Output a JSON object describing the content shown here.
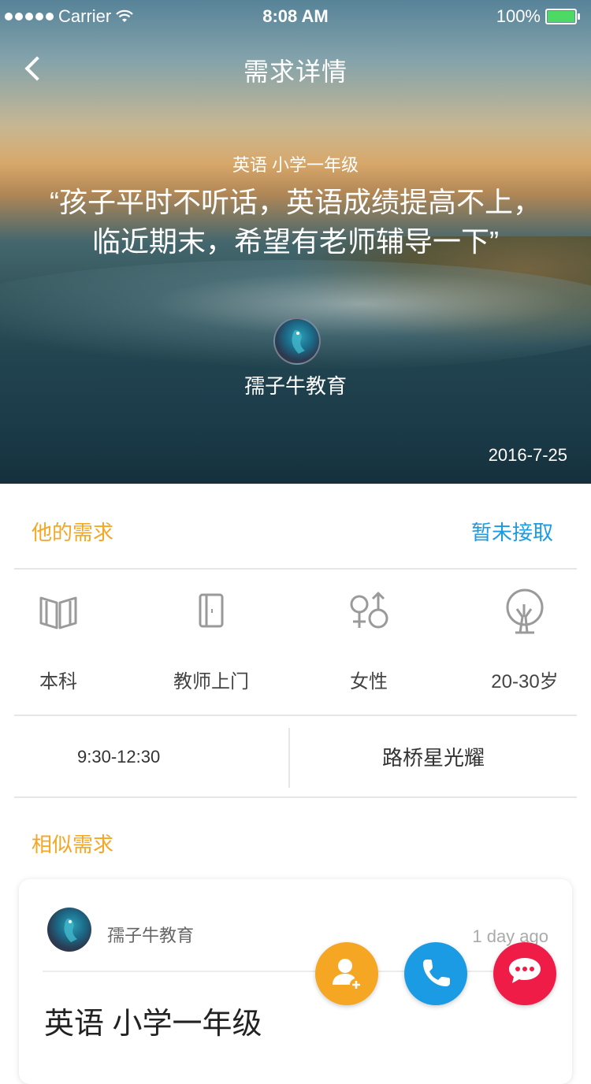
{
  "status_bar": {
    "carrier": "Carrier",
    "time": "8:08 AM",
    "battery": "100%"
  },
  "nav": {
    "title": "需求详情"
  },
  "hero": {
    "subject": "英语 小学一年级",
    "quote_line1": "“孩子平时不听话，英语成绩提高不上，",
    "quote_line2": "临近期末，希望有老师辅导一下”",
    "name": "孺子牛教育",
    "date": "2016-7-25"
  },
  "needs": {
    "title": "他的需求",
    "status": "暂未接取",
    "features": [
      {
        "label": "本科",
        "icon": "book-icon"
      },
      {
        "label": "教师上门",
        "icon": "door-icon"
      },
      {
        "label": "女性",
        "icon": "gender-icon"
      },
      {
        "label": "20-30岁",
        "icon": "tree-icon"
      }
    ],
    "time": "9:30-12:30",
    "location": "路桥星光耀"
  },
  "similar": {
    "title": "相似需求",
    "card": {
      "name": "孺子牛教育",
      "time": "1 day ago",
      "subject": "英语 小学一年级"
    }
  },
  "colors": {
    "accent_orange": "#f5a623",
    "accent_blue": "#1a9be3",
    "accent_red": "#ef1c48"
  }
}
